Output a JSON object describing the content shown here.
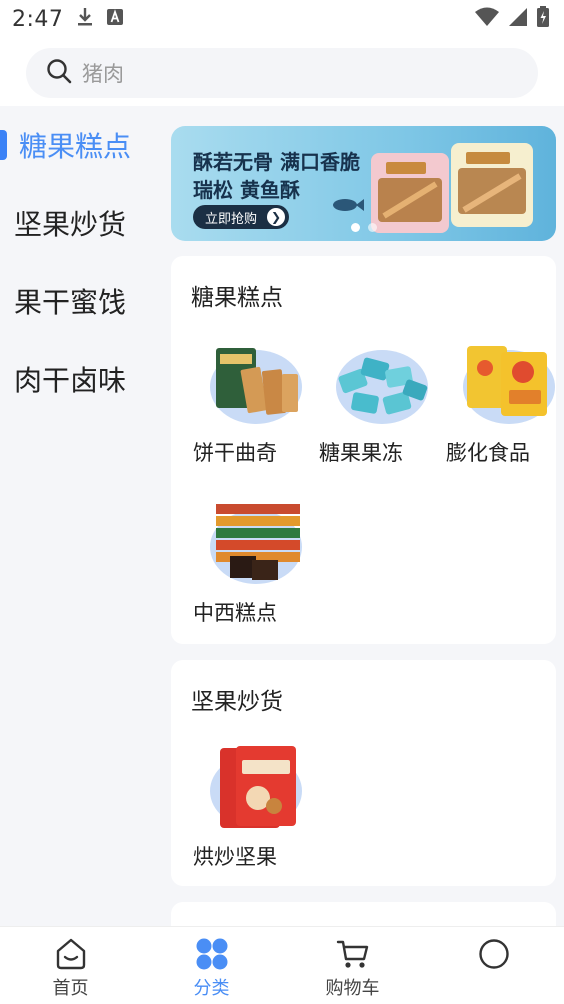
{
  "status_bar": {
    "time": "2:47"
  },
  "search": {
    "placeholder": "猪肉"
  },
  "sidebar": {
    "items": [
      {
        "label": "糖果糕点",
        "active": true
      },
      {
        "label": "坚果炒货",
        "active": false
      },
      {
        "label": "果干蜜饯",
        "active": false
      },
      {
        "label": "肉干卤味",
        "active": false
      }
    ]
  },
  "banner": {
    "line1": "酥若无骨 满口香脆",
    "line2": "瑞松 黄鱼酥",
    "button": "立即抢购",
    "colors": {
      "bg_start": "#a9dcef",
      "bg_end": "#5fb3dc"
    }
  },
  "sections": [
    {
      "title": "糖果糕点",
      "items": [
        {
          "label": "饼干曲奇"
        },
        {
          "label": "糖果果冻"
        },
        {
          "label": "膨化食品"
        },
        {
          "label": "中西糕点"
        }
      ]
    },
    {
      "title": "坚果炒货",
      "items": [
        {
          "label": "烘炒坚果"
        }
      ]
    }
  ],
  "tab_bar": {
    "tabs": [
      {
        "label": "首页",
        "icon": "home-icon",
        "active": false
      },
      {
        "label": "分类",
        "icon": "category-icon",
        "active": true
      },
      {
        "label": "购物车",
        "icon": "cart-icon",
        "active": false
      },
      {
        "label": "",
        "icon": "profile-icon",
        "active": false
      }
    ]
  },
  "accent_color": "#4a8ef5"
}
